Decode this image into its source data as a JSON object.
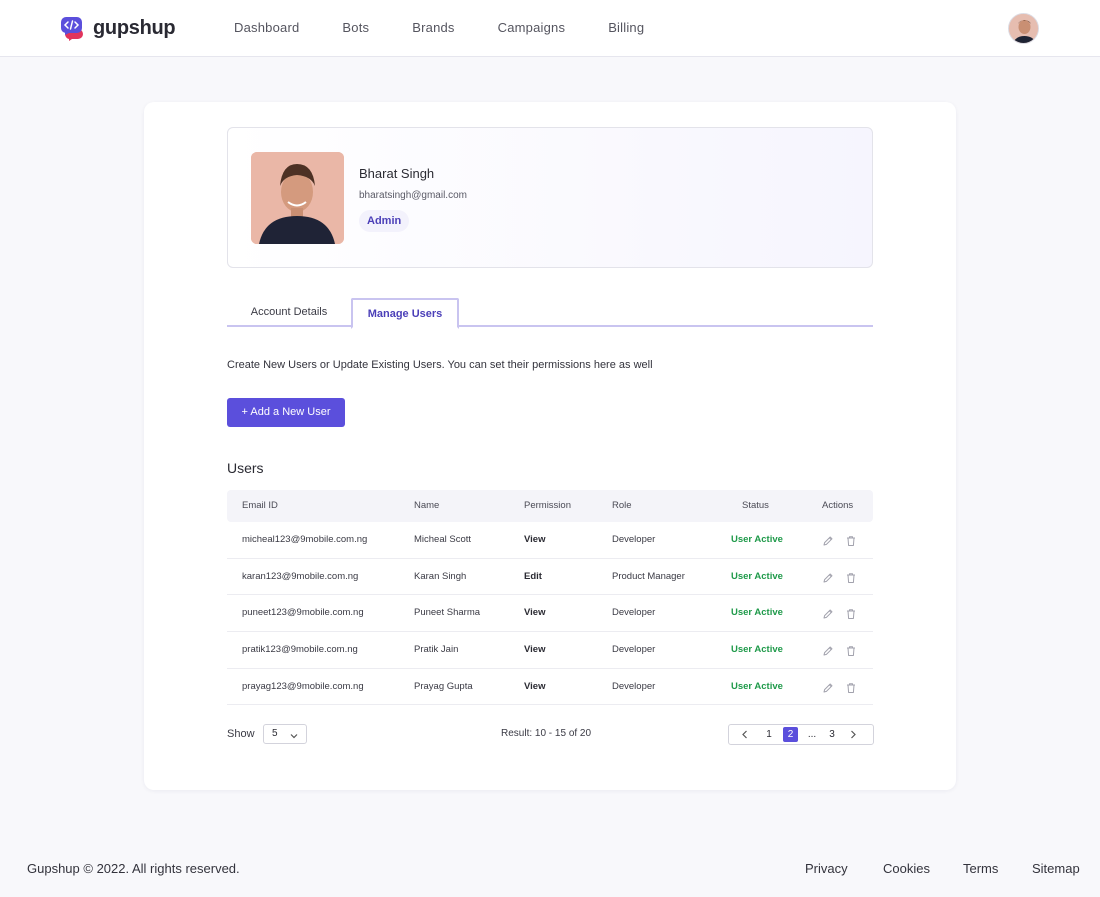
{
  "brand": {
    "name": "gupshup",
    "accent": "#5b4fdc",
    "logo_colors": [
      "#5b4fdc",
      "#e2345c"
    ]
  },
  "nav": {
    "items": [
      "Dashboard",
      "Bots",
      "Brands",
      "Campaigns",
      "Billing"
    ]
  },
  "profile": {
    "name": "Bharat Singh",
    "email": "bharatsingh@gmail.com",
    "role": "Admin"
  },
  "tabs": {
    "account": "Account Details",
    "manage": "Manage Users",
    "active": "Manage Users"
  },
  "manage": {
    "intro": "Create New Users or Update Existing Users. You can set their permissions here as well",
    "add_button": "+ Add a New User",
    "users_title": "Users"
  },
  "table": {
    "columns": [
      "Email ID",
      "Name",
      "Permission",
      "Role",
      "Status",
      "Actions"
    ],
    "rows": [
      {
        "email": "micheal123@9mobile.com.ng",
        "name": "Micheal Scott",
        "permission": "View",
        "role": "Developer",
        "status": "User Active"
      },
      {
        "email": "karan123@9mobile.com.ng",
        "name": "Karan Singh",
        "permission": "Edit",
        "role": "Product Manager",
        "status": "User Active"
      },
      {
        "email": "puneet123@9mobile.com.ng",
        "name": "Puneet Sharma",
        "permission": "View",
        "role": "Developer",
        "status": "User Active"
      },
      {
        "email": "pratik123@9mobile.com.ng",
        "name": "Pratik Jain",
        "permission": "View",
        "role": "Developer",
        "status": "User Active"
      },
      {
        "email": "prayag123@9mobile.com.ng",
        "name": "Prayag Gupta",
        "permission": "View",
        "role": "Developer",
        "status": "User Active"
      }
    ],
    "row_icons": [
      "pencil-icon",
      "trash-icon"
    ],
    "status_color": "#1f9a4a"
  },
  "pagination": {
    "show_label": "Show",
    "page_size": "5",
    "result": "Result: 10 - 15 of 20",
    "pages": [
      "1",
      "2",
      "...",
      "3"
    ],
    "current": "2"
  },
  "footer": {
    "copyright": "Gupshup © 2022. All rights reserved.",
    "links": [
      "Privacy",
      "Cookies",
      "Terms",
      "Sitemap"
    ]
  }
}
